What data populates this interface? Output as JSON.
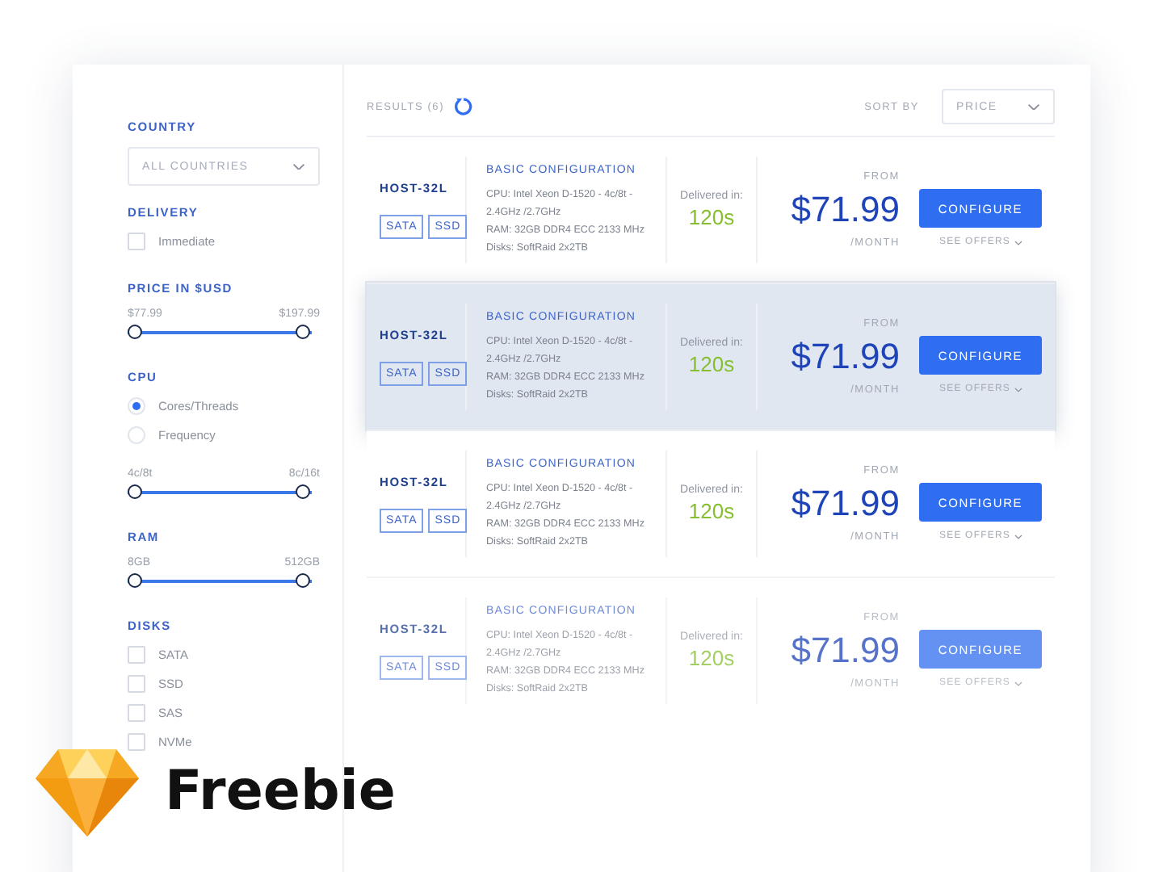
{
  "filters": [
    {
      "kind": "select",
      "title": "COUNTRY",
      "value": "ALL COUNTRIES"
    },
    {
      "kind": "checks",
      "title": "DELIVERY",
      "options": [
        {
          "label": "Immediate",
          "checked": false
        }
      ]
    },
    {
      "kind": "range",
      "title": "PRICE IN $USD",
      "min": "$77.99",
      "max": "$197.99",
      "level": 1
    },
    {
      "kind": "radios",
      "title": "CPU",
      "options": [
        {
          "label": "Cores/Threads",
          "selected": true
        },
        {
          "label": "Frequency",
          "selected": false
        }
      ]
    },
    {
      "kind": "range",
      "min": "4c/8t",
      "max": "8c/16t",
      "level": 1
    },
    {
      "kind": "range",
      "title": "RAM",
      "min": "8GB",
      "max": "512GB",
      "level": 1
    },
    {
      "kind": "checks",
      "title": "DISKS",
      "options": [
        {
          "label": "SATA",
          "checked": false
        },
        {
          "label": "SSD",
          "checked": false
        },
        {
          "label": "SAS",
          "checked": false
        },
        {
          "label": "NVMe",
          "checked": false
        }
      ]
    }
  ],
  "results": {
    "label": "RESULTS (6)",
    "sort_label": "SORT BY",
    "sort_value": "PRICE"
  },
  "offers": [
    {
      "name": "HOST-32L",
      "tags": [
        "SATA",
        "SSD"
      ],
      "config_title": "BASIC CONFIGURATION",
      "specs": [
        "CPU:  Intel Xeon D-1520 - 4c/8t - 2.4GHz /2.7GHz",
        "RAM:  32GB DDR4 ECC 2133 MHz",
        "Disks:  SoftRaid  2x2TB"
      ],
      "delivery_label": "Delivered in:",
      "delivery_time": "120s",
      "from": "FROM",
      "price": "$71.99",
      "period": "/MONTH",
      "button": "CONFIGURE",
      "offers_link": "SEE OFFERS",
      "highlighted": false
    },
    {
      "name": "HOST-32L",
      "tags": [
        "SATA",
        "SSD"
      ],
      "config_title": "BASIC CONFIGURATION",
      "specs": [
        "CPU:  Intel Xeon D-1520 - 4c/8t - 2.4GHz /2.7GHz",
        "RAM:  32GB DDR4 ECC 2133 MHz",
        "Disks:  SoftRaid  2x2TB"
      ],
      "delivery_label": "Delivered in:",
      "delivery_time": "120s",
      "from": "FROM",
      "price": "$71.99",
      "period": "/MONTH",
      "button": "CONFIGURE",
      "offers_link": "SEE OFFERS",
      "highlighted": true
    },
    {
      "name": "HOST-32L",
      "tags": [
        "SATA",
        "SSD"
      ],
      "config_title": "BASIC CONFIGURATION",
      "specs": [
        "CPU:  Intel Xeon D-1520 - 4c/8t - 2.4GHz /2.7GHz",
        "RAM:  32GB DDR4 ECC 2133 MHz",
        "Disks:  SoftRaid  2x2TB"
      ],
      "delivery_label": "Delivered in:",
      "delivery_time": "120s",
      "from": "FROM",
      "price": "$71.99",
      "period": "/MONTH",
      "button": "CONFIGURE",
      "offers_link": "SEE OFFERS",
      "highlighted": false
    },
    {
      "name": "HOST-32L",
      "tags": [
        "SATA",
        "SSD"
      ],
      "config_title": "BASIC CONFIGURATION",
      "specs": [
        "CPU:  Intel Xeon D-1520 - 4c/8t - 2.4GHz /2.7GHz",
        "RAM:  32GB DDR4 ECC 2133 MHz",
        "Disks:  SoftRaid  2x2TB"
      ],
      "delivery_label": "Delivered in:",
      "delivery_time": "120s",
      "from": "FROM",
      "price": "$71.99",
      "period": "/MONTH",
      "button": "CONFIGURE",
      "offers_link": "SEE OFFERS",
      "highlighted": false
    }
  ],
  "badge": {
    "title": "Freebie"
  }
}
